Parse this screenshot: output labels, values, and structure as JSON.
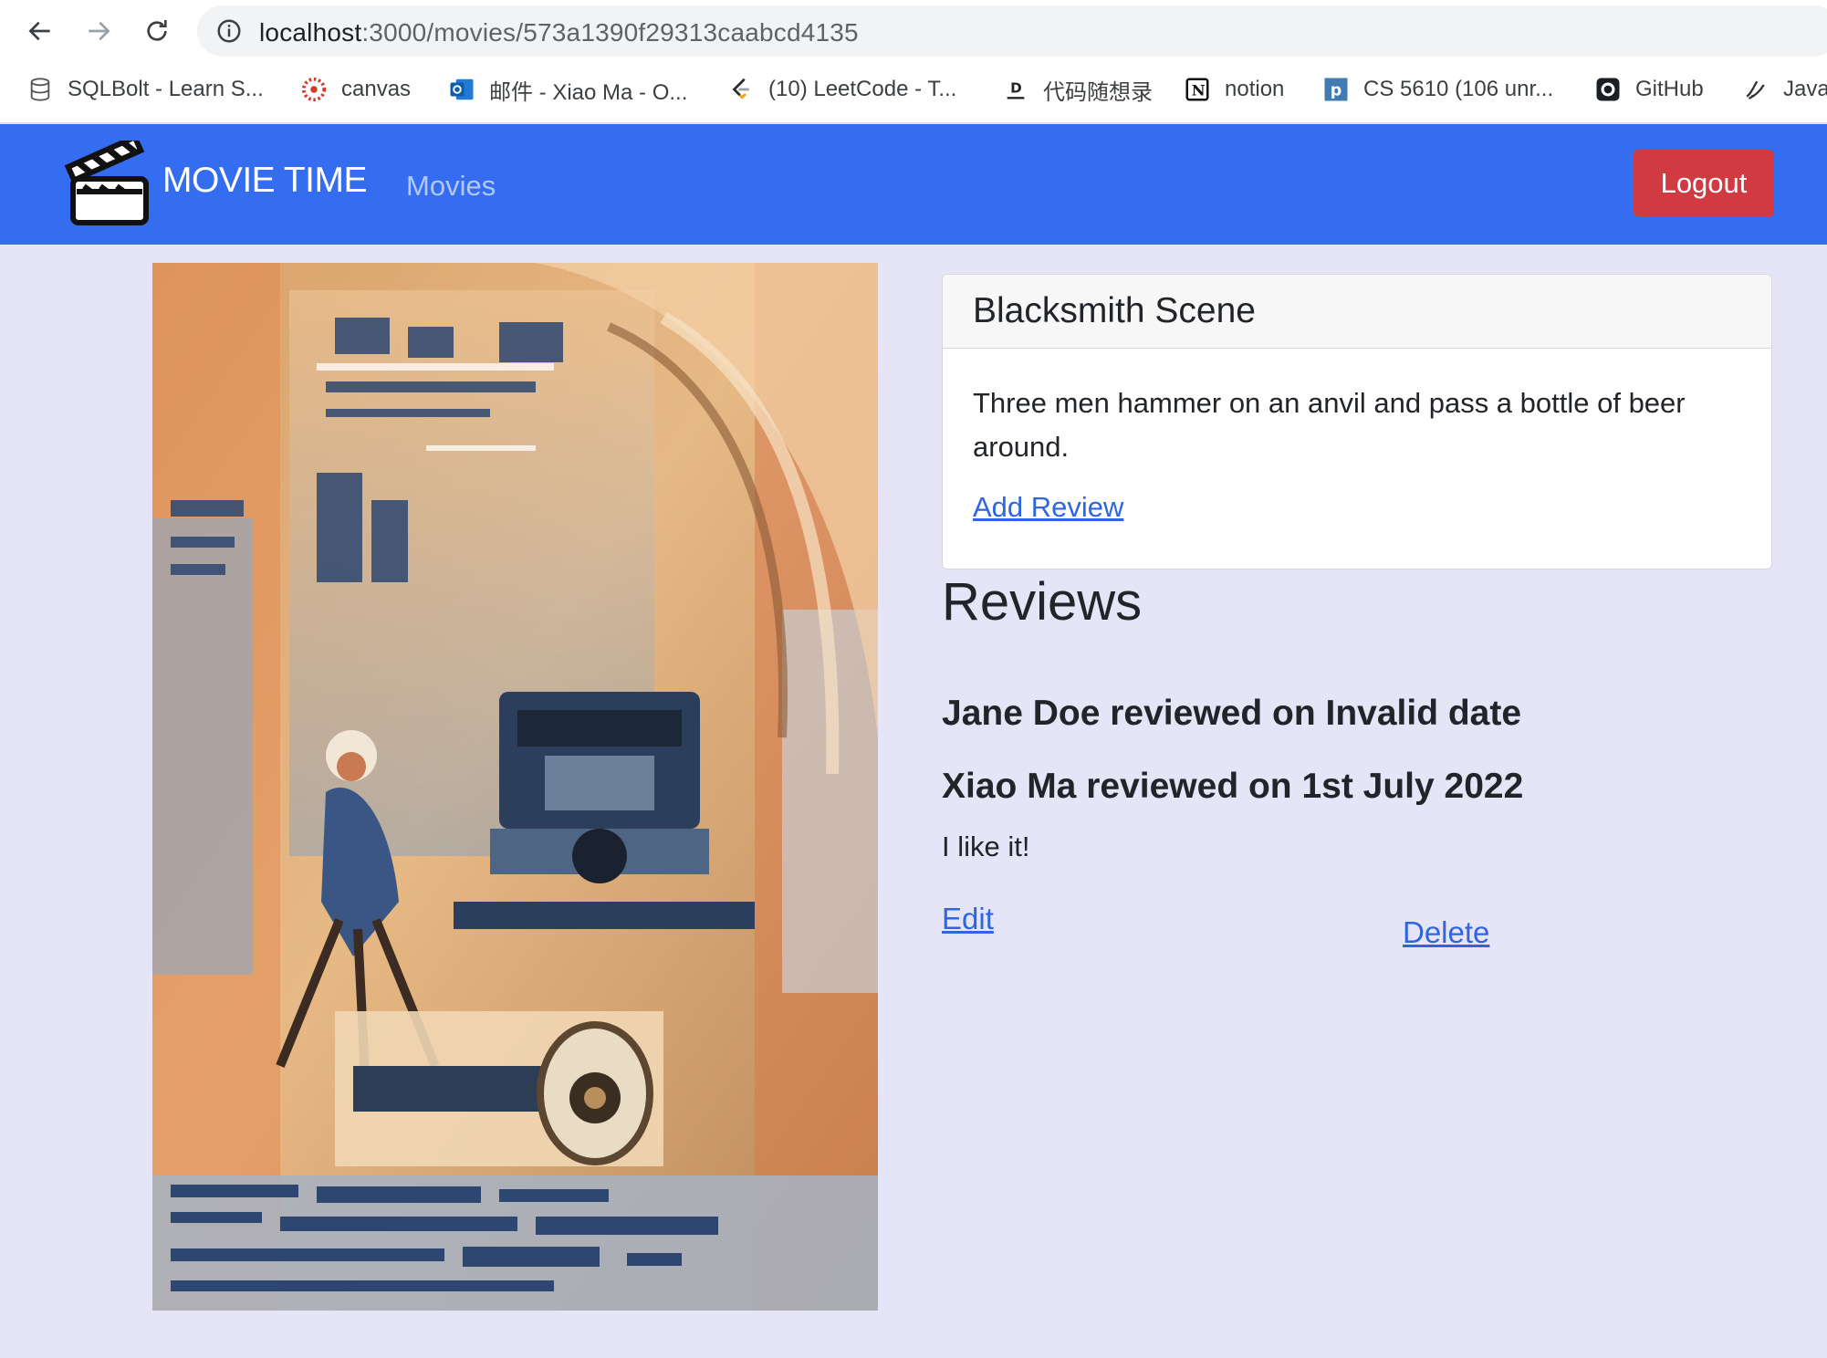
{
  "browser": {
    "url_host": "localhost",
    "url_path": ":3000/movies/573a1390f29313caabcd4135",
    "bookmarks": [
      {
        "label": "SQLBolt - Learn S...",
        "icon": "database-icon"
      },
      {
        "label": "canvas",
        "icon": "canvas-icon"
      },
      {
        "label": "邮件 - Xiao Ma - O...",
        "icon": "outlook-icon"
      },
      {
        "label": "(10) LeetCode - T...",
        "icon": "leetcode-icon"
      },
      {
        "label": "代码随想录",
        "icon": "code-site-icon"
      },
      {
        "label": "notion",
        "icon": "notion-icon"
      },
      {
        "label": "CS 5610 (106 unr...",
        "icon": "piazza-icon"
      },
      {
        "label": "GitHub",
        "icon": "github-icon"
      },
      {
        "label": "Java",
        "icon": "java-icon"
      }
    ]
  },
  "navbar": {
    "brand": "MOVIE TIME",
    "movies_link": "Movies",
    "logout_label": "Logout"
  },
  "movie": {
    "title": "Blacksmith Scene",
    "plot": "Three men hammer on an anvil and pass a bottle of beer around.",
    "add_review_label": "Add Review"
  },
  "reviews": {
    "heading": "Reviews",
    "items": [
      {
        "header": "Jane Doe reviewed on Invalid date",
        "text": ""
      },
      {
        "header": "Xiao Ma reviewed on 1st July 2022",
        "text": "I like it!",
        "edit_label": "Edit",
        "delete_label": "Delete"
      }
    ]
  },
  "colors": {
    "navbar": "#356df0",
    "logout": "#d13a43",
    "link": "#2f66e0",
    "page_bg": "#e6e5f7"
  }
}
